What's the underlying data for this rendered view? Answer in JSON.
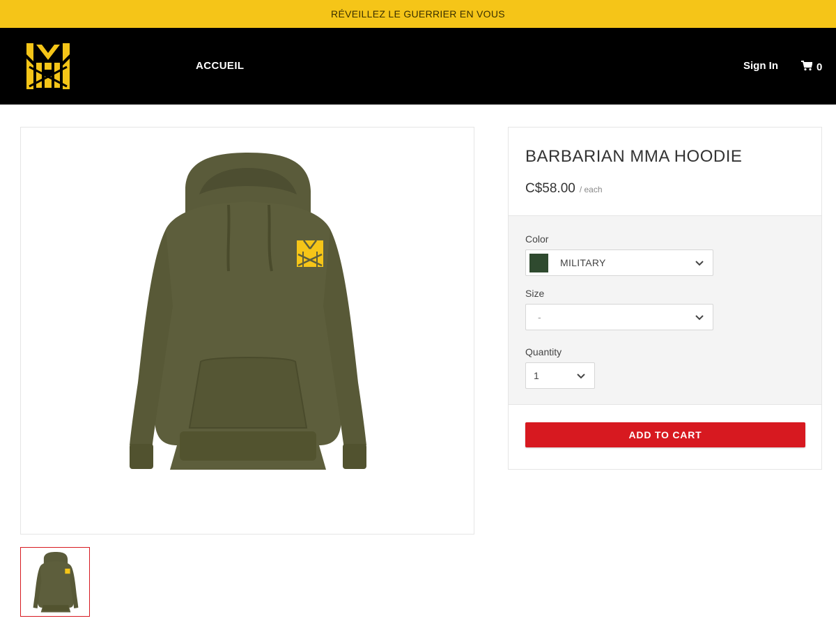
{
  "announcement": {
    "text": "RÉVEILLEZ LE GUERRIER EN VOUS"
  },
  "header": {
    "logo_icon": "mx-brand-logo",
    "nav": [
      {
        "label": "ACCUEIL"
      }
    ],
    "sign_in_label": "Sign In",
    "cart_icon": "cart-icon",
    "cart_count": "0"
  },
  "product": {
    "title": "BARBARIAN MMA HOODIE",
    "price": "C$58.00",
    "price_unit": "/ each",
    "hoodie_color": "#5b5c3a",
    "accent_color": "#f5c518"
  },
  "options": {
    "color": {
      "label": "Color",
      "value": "MILITARY",
      "swatch_color": "#2f4a2f"
    },
    "size": {
      "label": "Size",
      "value": "-"
    },
    "quantity": {
      "label": "Quantity",
      "value": "1"
    }
  },
  "actions": {
    "add_to_cart_label": "ADD TO CART",
    "button_color": "#d71920"
  },
  "thumbnails": [
    {
      "selected": true
    }
  ]
}
